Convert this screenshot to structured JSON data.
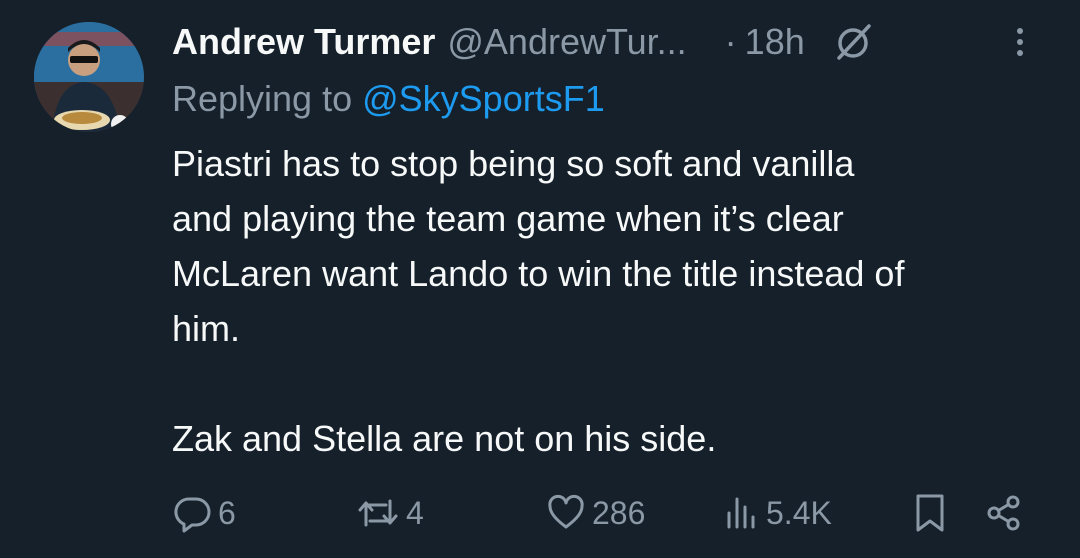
{
  "tweet": {
    "author_name": "Andrew Turmer",
    "author_handle": "@AndrewTur...",
    "separator": "·",
    "time": "18h",
    "replying_prefix": "Replying to ",
    "replying_to": "@SkySportsF1",
    "paragraphs": [
      "Piastri has to stop being so soft and vanilla\nand playing the team game when it’s clear\nMcLaren want Lando to win the title instead of\nhim.",
      "Zak and Stella are not on his side."
    ]
  },
  "actions": {
    "replies": "6",
    "reposts": "4",
    "likes": "286",
    "views": "5.4K"
  },
  "icons": {
    "grok": "grok-icon",
    "more": "more-icon",
    "reply": "reply-icon",
    "repost": "repost-icon",
    "like": "heart-icon",
    "views": "views-icon",
    "bookmark": "bookmark-icon",
    "share": "share-icon"
  },
  "colors": {
    "background": "#15202b",
    "text": "#f7f9f9",
    "muted": "#8b98a5",
    "link": "#1d9bf0"
  }
}
